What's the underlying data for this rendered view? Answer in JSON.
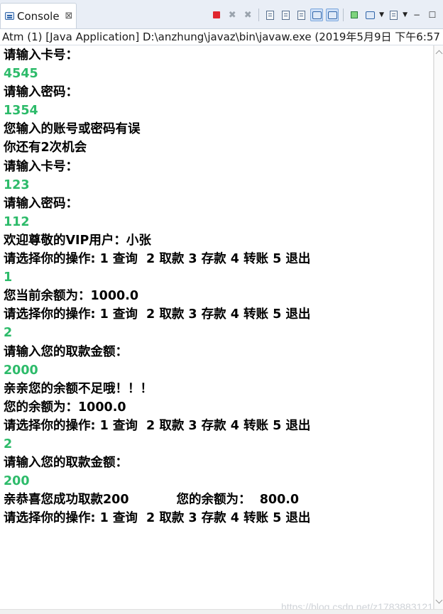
{
  "tab": {
    "title": "Console",
    "close_glyph": "⊠"
  },
  "toolbar": {
    "icons": [
      "terminate-icon",
      "remove-launch-icon",
      "remove-all-terminated-icon",
      "word-wrap-icon",
      "scroll-lock-icon",
      "clear-console-icon",
      "show-on-stdout-icon",
      "show-on-stderr-icon",
      "pin-console-icon",
      "display-console-icon",
      "open-console-icon",
      "minimize-icon",
      "maximize-icon"
    ],
    "terminate_color": "#e0262e"
  },
  "status_line": "Atm (1) [Java Application] D:\\anzhung\\javaz\\bin\\javaw.exe (2019年5月9日 下午6:57",
  "console": {
    "output_color": "#000000",
    "input_color": "#2dbb6a",
    "lines": [
      {
        "text": "请输入卡号：",
        "kind": "output"
      },
      {
        "text": "4545",
        "kind": "input"
      },
      {
        "text": "请输入密码：",
        "kind": "output"
      },
      {
        "text": "1354",
        "kind": "input"
      },
      {
        "text": "您输入的账号或密码有误",
        "kind": "output"
      },
      {
        "text": "你还有2次机会",
        "kind": "output"
      },
      {
        "text": "请输入卡号：",
        "kind": "output"
      },
      {
        "text": "123",
        "kind": "input"
      },
      {
        "text": "请输入密码：",
        "kind": "output"
      },
      {
        "text": "112",
        "kind": "input"
      },
      {
        "text": "欢迎尊敬的VIP用户：小张",
        "kind": "output"
      },
      {
        "text": "请选择你的操作: 1 查询  2 取款 3 存款 4 转账 5 退出",
        "kind": "output"
      },
      {
        "text": "1",
        "kind": "input"
      },
      {
        "text": "您当前余额为：1000.0",
        "kind": "output"
      },
      {
        "text": "请选择你的操作: 1 查询  2 取款 3 存款 4 转账 5 退出",
        "kind": "output"
      },
      {
        "text": "2",
        "kind": "input"
      },
      {
        "text": "请输入您的取款金额：",
        "kind": "output"
      },
      {
        "text": "2000",
        "kind": "input"
      },
      {
        "text": "亲亲您的余额不足哦！！！",
        "kind": "output"
      },
      {
        "text": "您的余额为：1000.0",
        "kind": "output"
      },
      {
        "text": "请选择你的操作: 1 查询  2 取款 3 存款 4 转账 5 退出",
        "kind": "output"
      },
      {
        "text": "2",
        "kind": "input"
      },
      {
        "text": "请输入您的取款金额：",
        "kind": "output"
      },
      {
        "text": "200",
        "kind": "input"
      },
      {
        "text": "亲恭喜您成功取款200           您的余额为：  800.0",
        "kind": "output"
      },
      {
        "text": "请选择你的操作: 1 查询  2 取款 3 存款 4 转账 5 退出",
        "kind": "output"
      }
    ]
  },
  "watermark": "https://blog.csdn.net/z1783883121"
}
